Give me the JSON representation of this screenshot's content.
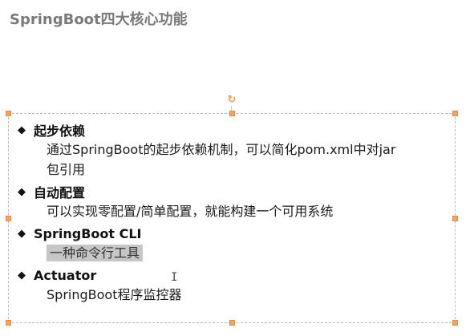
{
  "slide": {
    "title": "SpringBoot四大核心功能",
    "sections": [
      {
        "heading": "起步依赖",
        "description_lines": [
          "通过SpringBoot的起步依赖机制，可以简化pom.xml中对jar",
          "包引用"
        ]
      },
      {
        "heading": "自动配置",
        "description_lines": [
          "可以实现零配置/简单配置，就能构建一个可用系统"
        ]
      },
      {
        "heading": "SpringBoot CLI",
        "description_lines": [
          "一种命令行工具"
        ],
        "highlighted": true
      },
      {
        "heading": "Actuator",
        "description_lines": [
          "SpringBoot程序监控器"
        ]
      }
    ],
    "bullet_glyph": "◆",
    "rotate_glyph": "↻"
  },
  "colors": {
    "title": "#7a7a7a",
    "handle": "#f0a468",
    "highlight": "#c6c6c6"
  }
}
